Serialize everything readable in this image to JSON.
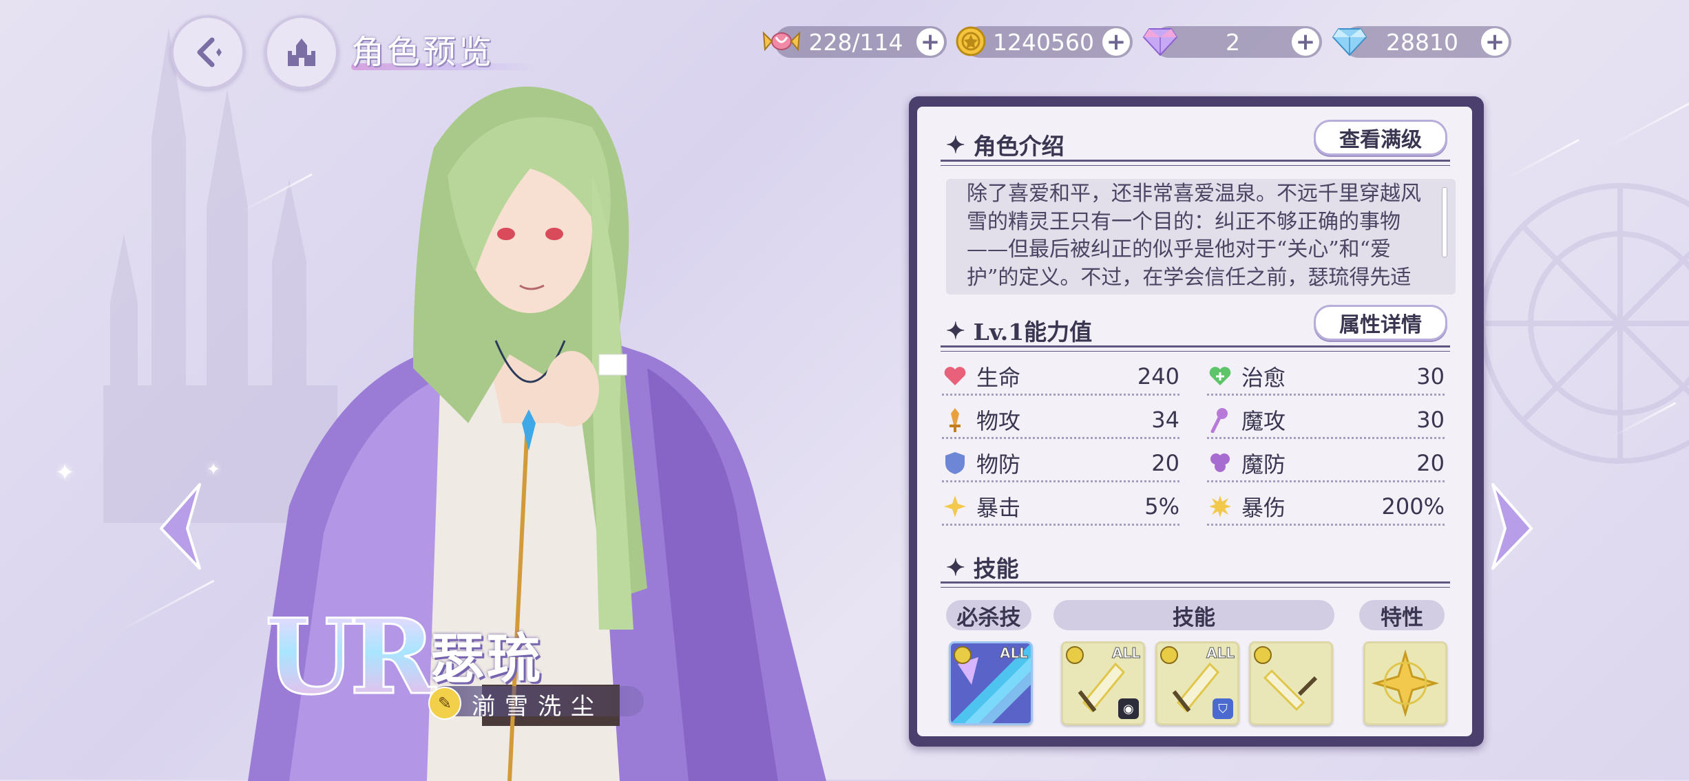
{
  "header": {
    "page_title": "角色预览",
    "back_icon": "back-arrow-icon",
    "home_icon": "castle-icon"
  },
  "resources": [
    {
      "icon": "candy-icon",
      "value": "228/114"
    },
    {
      "icon": "gold-coin-icon",
      "value": "1240560"
    },
    {
      "icon": "pink-gem-icon",
      "value": "2"
    },
    {
      "icon": "blue-diamond-icon",
      "value": "28810"
    }
  ],
  "character": {
    "rarity": "UR",
    "name": "瑟琉",
    "title": "湔雪洗尘"
  },
  "intro": {
    "heading": "角色介绍",
    "button": "查看满级",
    "text": "除了喜爱和平，还非常喜爱温泉。不远千里穿越风雪的精灵王只有一个目的：纠正不够正确的事物——但最后被纠正的似乎是他对于“关心”和“爱护”的定义。不过，在学会信任之前，瑟琉得先适"
  },
  "stats": {
    "heading": "Lv.1能力值",
    "button": "属性详情",
    "items": [
      {
        "label": "生命",
        "value": "240",
        "icon": "heart-icon",
        "color": "#e8607a"
      },
      {
        "label": "治愈",
        "value": "30",
        "icon": "heal-heart-icon",
        "color": "#5ec46a"
      },
      {
        "label": "物攻",
        "value": "34",
        "icon": "sword-icon",
        "color": "#e9a23b"
      },
      {
        "label": "魔攻",
        "value": "30",
        "icon": "magic-staff-icon",
        "color": "#b77ad8"
      },
      {
        "label": "物防",
        "value": "20",
        "icon": "shield-icon",
        "color": "#6d86d6"
      },
      {
        "label": "魔防",
        "value": "20",
        "icon": "magic-defense-icon",
        "color": "#a66cd0"
      },
      {
        "label": "暴击",
        "value": "5%",
        "icon": "crit-star-icon",
        "color": "#f2c94c"
      },
      {
        "label": "暴伤",
        "value": "200%",
        "icon": "crit-burst-icon",
        "color": "#f2c94c"
      }
    ]
  },
  "skills": {
    "heading": "技能",
    "tags": {
      "ultimate": "必杀技",
      "skills": "技能",
      "trait": "特性"
    },
    "items": [
      {
        "name": "ultimate-skill",
        "all": "ALL"
      },
      {
        "name": "skill-1",
        "all": "ALL"
      },
      {
        "name": "skill-2",
        "all": "ALL"
      },
      {
        "name": "skill-3",
        "all": ""
      },
      {
        "name": "trait",
        "all": ""
      }
    ]
  }
}
